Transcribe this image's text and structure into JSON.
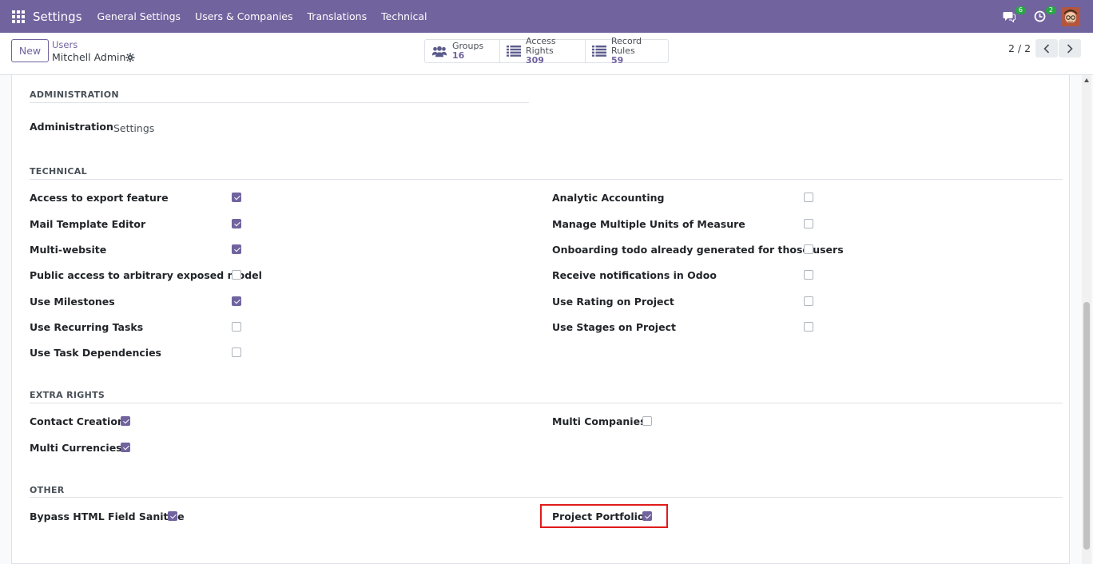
{
  "navbar": {
    "app_name": "Settings",
    "menu": [
      "General Settings",
      "Users & Companies",
      "Translations",
      "Technical"
    ],
    "messages_count": "6",
    "activities_count": "2"
  },
  "control_panel": {
    "new_label": "New",
    "breadcrumb_parent": "Users",
    "breadcrumb_current": "Mitchell Admin",
    "smart_buttons": [
      {
        "label": "Groups",
        "value": "16",
        "icon": "users-icon"
      },
      {
        "label": "Access Rights",
        "value": "309",
        "icon": "list-icon"
      },
      {
        "label": "Record Rules",
        "value": "59",
        "icon": "list-icon"
      }
    ],
    "pager": "2 / 2"
  },
  "sections": {
    "administration": {
      "title": "ADMINISTRATION",
      "field_label": "Administration",
      "field_value": "Settings"
    },
    "technical": {
      "title": "TECHNICAL",
      "left": [
        {
          "label": "Access to export feature",
          "checked": true
        },
        {
          "label": "Mail Template Editor",
          "checked": true
        },
        {
          "label": "Multi-website",
          "checked": true
        },
        {
          "label": "Public access to arbitrary exposed model",
          "checked": false
        },
        {
          "label": "Use Milestones",
          "checked": true
        },
        {
          "label": "Use Recurring Tasks",
          "checked": false
        },
        {
          "label": "Use Task Dependencies",
          "checked": false
        }
      ],
      "right": [
        {
          "label": "Analytic Accounting",
          "checked": false
        },
        {
          "label": "Manage Multiple Units of Measure",
          "checked": false
        },
        {
          "label": "Onboarding todo already generated for those users",
          "checked": false
        },
        {
          "label": "Receive notifications in Odoo",
          "checked": false
        },
        {
          "label": "Use Rating on Project",
          "checked": false
        },
        {
          "label": "Use Stages on Project",
          "checked": false
        }
      ]
    },
    "extra_rights": {
      "title": "EXTRA RIGHTS",
      "left": [
        {
          "label": "Contact Creation",
          "checked": true
        },
        {
          "label": "Multi Currencies",
          "checked": true
        }
      ],
      "right": [
        {
          "label": "Multi Companies",
          "checked": false
        }
      ]
    },
    "other": {
      "title": "OTHER",
      "left": [
        {
          "label": "Bypass HTML Field Sanitize",
          "checked": true
        }
      ],
      "right": [
        {
          "label": "Project Portfolio",
          "checked": true
        }
      ]
    }
  },
  "colors": {
    "brand": "#71639e",
    "highlight": "#e01b1b",
    "badge": "#28a745"
  }
}
